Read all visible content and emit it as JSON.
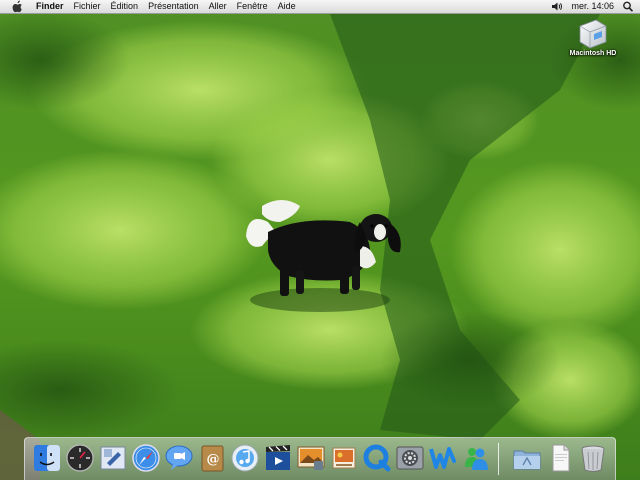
{
  "menubar": {
    "apple_icon": "apple-icon",
    "items": [
      "Finder",
      "Fichier",
      "Édition",
      "Présentation",
      "Aller",
      "Fenêtre",
      "Aide"
    ],
    "clock": "mer. 14:06",
    "volume_icon": "volume-icon",
    "spotlight_icon": "spotlight-search-icon"
  },
  "desktop": {
    "icons": [
      {
        "label": "Macintosh HD",
        "icon": "hard-drive-icon"
      }
    ],
    "wallpaper": "photo of a black and white dog standing on sunlit grass"
  },
  "dock": {
    "apps": [
      {
        "icon": "finder-icon"
      },
      {
        "icon": "dashboard-icon"
      },
      {
        "icon": "mail-icon"
      },
      {
        "icon": "safari-icon"
      },
      {
        "icon": "ichat-icon"
      },
      {
        "icon": "address-book-icon"
      },
      {
        "icon": "itunes-icon"
      },
      {
        "icon": "imovie-icon"
      },
      {
        "icon": "iphoto-icon"
      },
      {
        "icon": "iphoto-slideshow-icon"
      },
      {
        "icon": "quicktime-icon"
      },
      {
        "icon": "system-preferences-icon"
      },
      {
        "icon": "iweb-icon"
      },
      {
        "icon": "messenger-icon"
      }
    ],
    "docs": [
      {
        "icon": "applications-folder-icon"
      },
      {
        "icon": "documents-stack-icon"
      },
      {
        "icon": "trash-icon"
      }
    ]
  },
  "colors": {
    "grass_light": "#9fd24a",
    "grass_dark": "#2f6d17",
    "menubar": "#e8e8e8"
  }
}
